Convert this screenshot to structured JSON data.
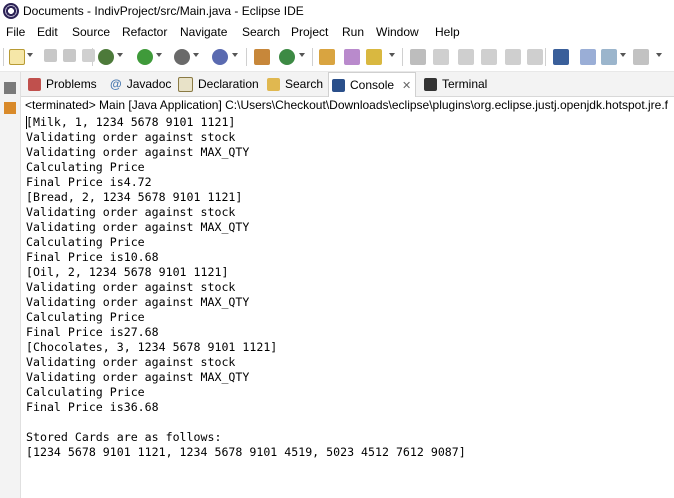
{
  "window": {
    "title": "Documents - IndivProject/src/Main.java - Eclipse IDE"
  },
  "menu": [
    "File",
    "Edit",
    "Source",
    "Refactor",
    "Navigate",
    "Search",
    "Project",
    "Run",
    "Window",
    "Help"
  ],
  "tabs": [
    {
      "label": "Problems",
      "icon": "problems-icon"
    },
    {
      "label": "Javadoc",
      "icon": "javadoc-icon"
    },
    {
      "label": "Declaration",
      "icon": "declaration-icon"
    },
    {
      "label": "Search",
      "icon": "search-icon"
    },
    {
      "label": "Console",
      "icon": "console-icon",
      "active": true
    },
    {
      "label": "Terminal",
      "icon": "terminal-icon"
    }
  ],
  "console": {
    "header": "<terminated> Main [Java Application] C:\\Users\\Checkout\\Downloads\\eclipse\\plugins\\org.eclipse.justj.openjdk.hotspot.jre.f",
    "lines": [
      "[Milk, 1, 1234 5678 9101 1121]",
      "Validating order against stock",
      "Validating order against MAX_QTY",
      "Calculating Price",
      "Final Price is4.72",
      "[Bread, 2, 1234 5678 9101 1121]",
      "Validating order against stock",
      "Validating order against MAX_QTY",
      "Calculating Price",
      "Final Price is10.68",
      "[Oil, 2, 1234 5678 9101 1121]",
      "Validating order against stock",
      "Validating order against MAX_QTY",
      "Calculating Price",
      "Final Price is27.68",
      "[Chocolates, 3, 1234 5678 9101 1121]",
      "Validating order against stock",
      "Validating order against MAX_QTY",
      "Calculating Price",
      "Final Price is36.68",
      "",
      "Stored Cards are as follows:",
      "[1234 5678 9101 1121, 1234 5678 9101 4519, 5023 4512 7612 9087]"
    ]
  }
}
